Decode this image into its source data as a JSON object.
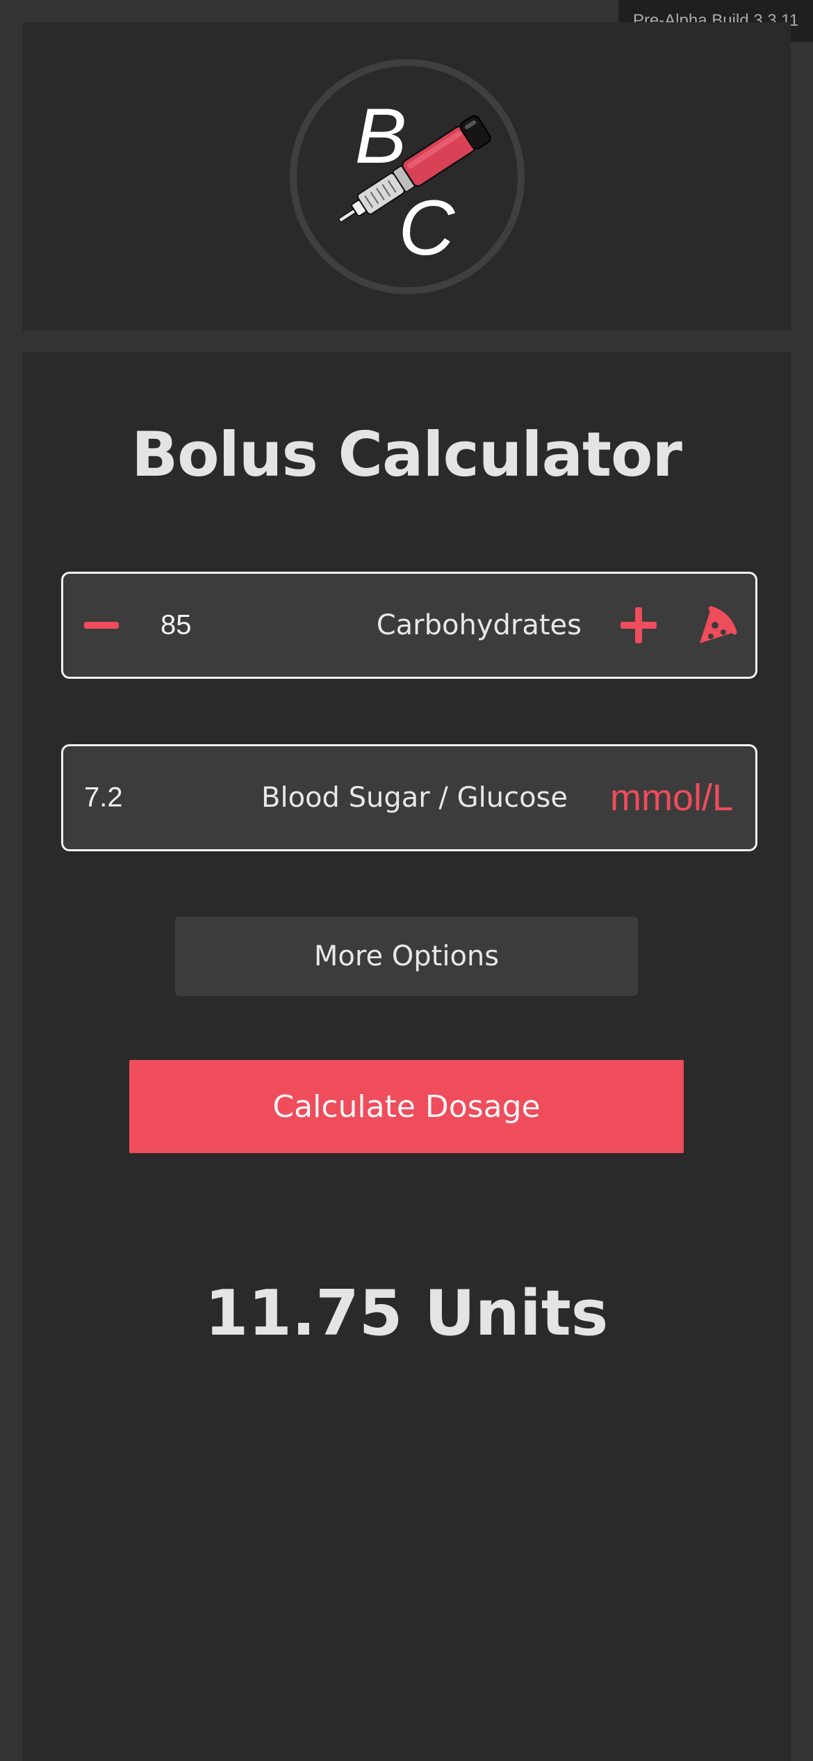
{
  "build_badge": "Pre-Alpha Build 3.3.11",
  "logo": {
    "letter_top": "B",
    "letter_bottom": "C",
    "icon": "insulin-pen-icon"
  },
  "title": "Bolus Calculator",
  "carbs": {
    "value": "85",
    "label": "Carbohydrates",
    "minus_icon": "minus-icon",
    "plus_icon": "plus-icon",
    "food_icon": "pizza-icon"
  },
  "glucose": {
    "value": "7.2",
    "label": "Blood Sugar / Glucose",
    "unit": "mmol/L"
  },
  "more_options_label": "More Options",
  "calculate_label": "Calculate Dosage",
  "result": "11.75 Units",
  "colors": {
    "accent": "#ef4c5c",
    "background": "#333333",
    "panel": "#2a2a2a",
    "field": "#3c3c3c"
  }
}
